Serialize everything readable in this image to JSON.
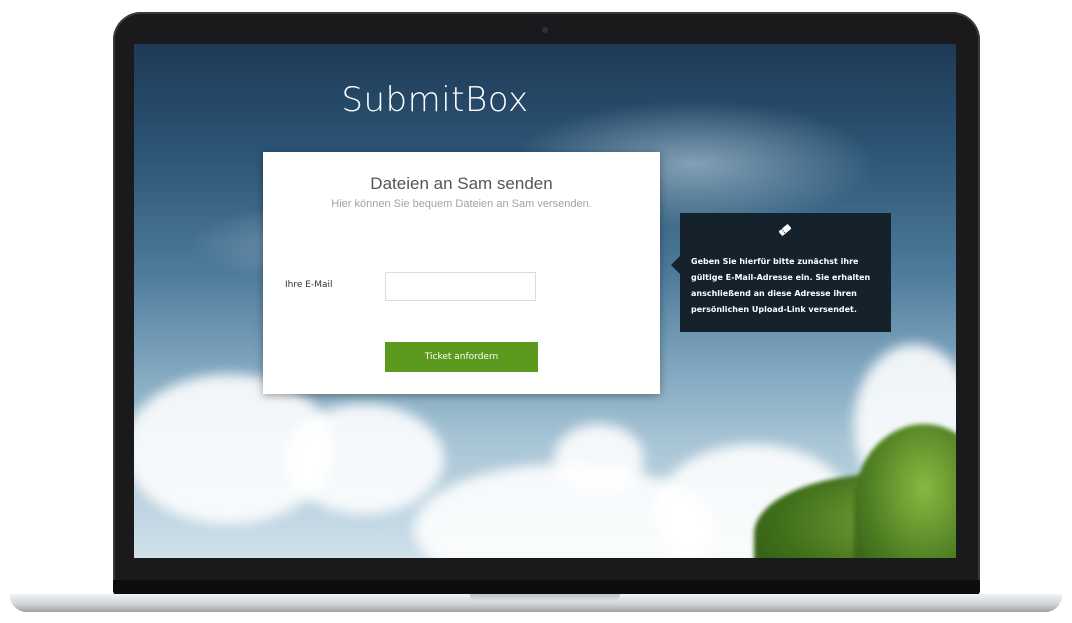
{
  "brand": {
    "title": "SubmitBox"
  },
  "card": {
    "title": "Dateien an Sam senden",
    "subtitle": "Hier können Sie bequem Dateien an Sam versenden."
  },
  "form": {
    "email_label": "Ihre E-Mail",
    "email_value": "",
    "email_placeholder": "",
    "submit_label": "Ticket anfordern"
  },
  "tooltip": {
    "icon": "ticket-icon",
    "text": "Geben Sie hierfür bitte zunächst ihre gültige E-Mail-Adresse ein. Sie erhalten anschließend an diese Adresse ihren persönlichen Upload-Link versendet."
  },
  "colors": {
    "accent": "#5b9a1f",
    "tooltip_bg": "#16222b",
    "card_bg": "#ffffff"
  }
}
